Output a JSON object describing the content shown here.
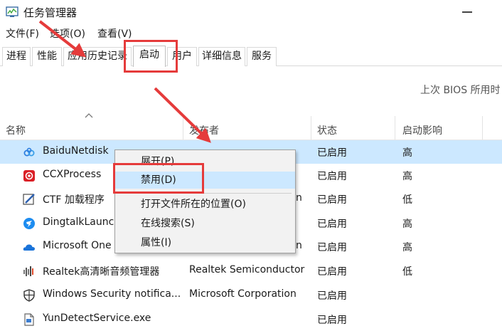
{
  "window": {
    "title": "任务管理器"
  },
  "menu": [
    "文件(F)",
    "选项(O)",
    "查看(V)"
  ],
  "tabs": [
    "进程",
    "性能",
    "应用历史记录",
    "启动",
    "用户",
    "详细信息",
    "服务"
  ],
  "active_tab": "启动",
  "bios_text": "上次 BIOS 所用时",
  "columns": {
    "name": "名称",
    "publisher": "发布者",
    "status": "状态",
    "impact": "启动影响"
  },
  "rows": [
    {
      "name": "BaiduNetdisk",
      "publisher": "",
      "status": "已启用",
      "impact": "高",
      "icon": "baidunetdisk-icon"
    },
    {
      "name": "CCXProcess",
      "publisher": "",
      "status": "已启用",
      "impact": "高",
      "icon": "ccxprocess-icon"
    },
    {
      "name": "CTF 加载程序",
      "publisher": "n",
      "status": "已启用",
      "impact": "低",
      "icon": "ctf-loader-icon"
    },
    {
      "name": "DingtalkLaunc",
      "publisher": "",
      "status": "已启用",
      "impact": "高",
      "icon": "dingtalk-icon"
    },
    {
      "name": "Microsoft One",
      "publisher": "n",
      "status": "已启用",
      "impact": "高",
      "icon": "onedrive-icon"
    },
    {
      "name": "Realtek高清晰音频管理器",
      "publisher": "Realtek Semiconductor",
      "status": "已启用",
      "impact": "低",
      "icon": "realtek-audio-icon"
    },
    {
      "name": "Windows Security notifica...",
      "publisher": "Microsoft Corporation",
      "status": "已启用",
      "impact": "",
      "icon": "windows-security-icon"
    },
    {
      "name": "YunDetectService.exe",
      "publisher": "",
      "status": "已启用",
      "impact": "",
      "icon": "yundetect-icon"
    }
  ],
  "context_menu": {
    "expand": "展开(P)",
    "disable": "禁用(D)",
    "open_location": "打开文件所在的位置(O)",
    "search_online": "在线搜索(S)",
    "properties": "属性(I)"
  },
  "colors": {
    "selection": "#cce8ff",
    "annotation": "#e53b3b"
  }
}
